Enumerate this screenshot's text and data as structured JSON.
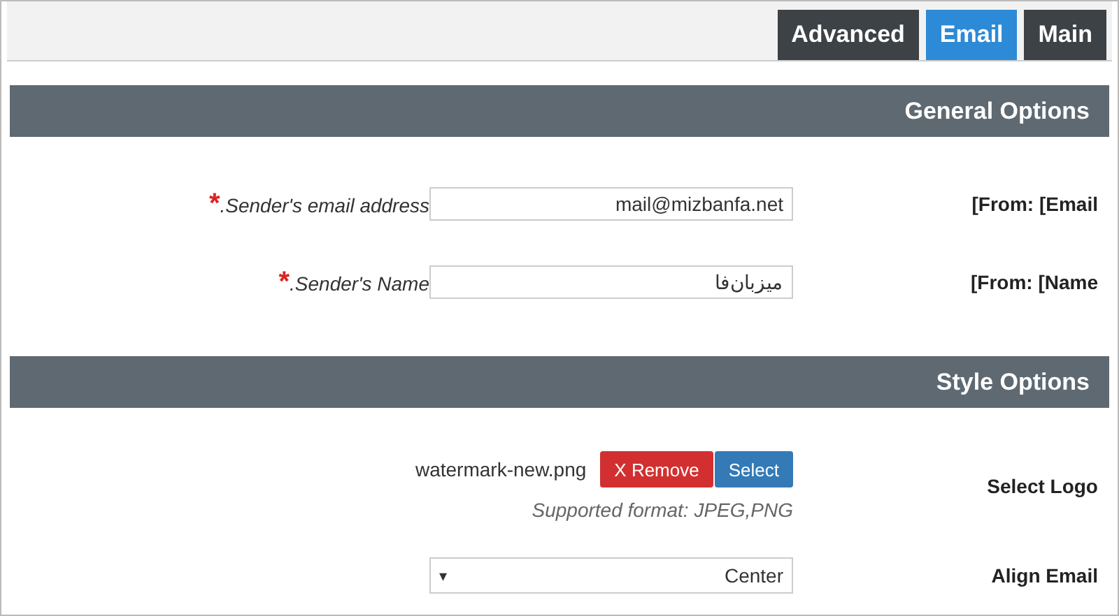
{
  "tabs": [
    {
      "label": "Advanced",
      "selected": false
    },
    {
      "label": "Email",
      "selected": true
    },
    {
      "label": "Main",
      "selected": false
    }
  ],
  "sections": [
    {
      "title": "General Options",
      "rows": [
        {
          "kind": "text",
          "label": "[From: [Email",
          "description": ".Sender's email address",
          "required_mark": "*",
          "value": "mail@mizbanfa.net"
        },
        {
          "kind": "text",
          "label": "[From: [Name",
          "description": ".Sender's Name",
          "required_mark": "*",
          "value": "میزبان‌فا"
        }
      ]
    },
    {
      "title": "Style Options",
      "rows": [
        {
          "kind": "file",
          "label": "Select Logo",
          "file_name": "watermark-new.png",
          "remove_button": "X Remove",
          "select_button": "Select",
          "hint": "Supported format: JPEG,PNG"
        },
        {
          "kind": "select",
          "label": "Align Email",
          "caret": "▾",
          "value": "Center"
        }
      ]
    }
  ]
}
